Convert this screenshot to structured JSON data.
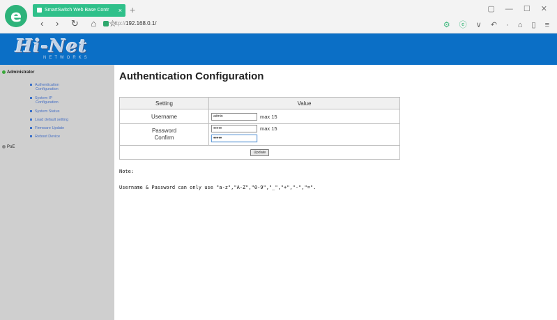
{
  "browser": {
    "tab_title": "SmartSwitch Web Base Contr",
    "tab_close": "×",
    "new_tab": "+",
    "window_controls": "▢ — ☐ ✕",
    "nav_icons": "‹ › ↻ ⌂ ☆",
    "url_scheme": "http://",
    "url_host": "192.168.0.1/",
    "toolbar_icons_green": "⚙ ⓔ",
    "toolbar_icons": "∨ ↶ · ⌂ ▯ ≡"
  },
  "header": {
    "brand": "Hi-Net",
    "brand_sub": "NETWORKS",
    "banner_color": "#0b6fc6"
  },
  "sidebar": {
    "group1": "Administrator",
    "items": [
      {
        "label1": "Authentication",
        "label2": "Configuration"
      },
      {
        "label1": "System IP",
        "label2": "Configuration"
      },
      {
        "label1": "System Status",
        "label2": ""
      },
      {
        "label1": "Load default setting",
        "label2": ""
      },
      {
        "label1": "Firmware Update",
        "label2": ""
      },
      {
        "label1": "Reboot Device",
        "label2": ""
      }
    ],
    "group2": "PoE"
  },
  "main": {
    "title": "Authentication Configuration",
    "table": {
      "col_setting": "Setting",
      "col_value": "Value",
      "username_label": "Username",
      "username_value": "admin",
      "username_max": "max 15",
      "password_label": "Password",
      "confirm_label": "Confirm",
      "password_value": "•••••",
      "confirm_value": "•••••",
      "password_max": "max 15",
      "update_button": "Update"
    },
    "note_heading": "Note:",
    "note_text": "Username & Password can only use \"a-z\",\"A-Z\",\"0-9\",\"_\",\"+\",\"-\",\"=\"."
  }
}
